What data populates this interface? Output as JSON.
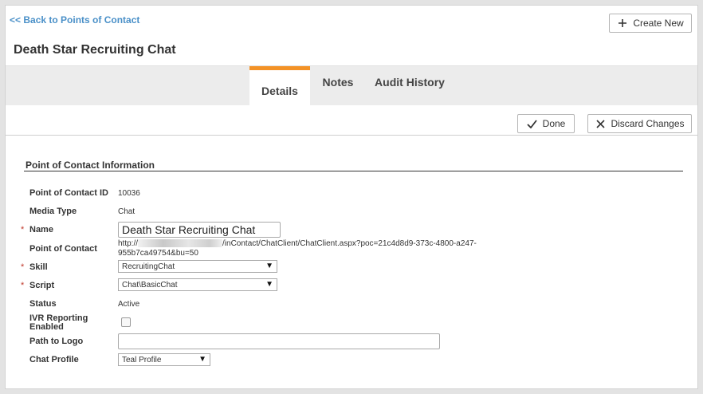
{
  "header": {
    "back_link": "<< Back to Points of Contact",
    "create_new_label": "Create New",
    "page_title": "Death Star Recruiting Chat"
  },
  "tabs": [
    {
      "label": "Details",
      "active": true
    },
    {
      "label": "Notes",
      "active": false
    },
    {
      "label": "Audit History",
      "active": false
    }
  ],
  "toolbar": {
    "done_label": "Done",
    "discard_label": "Discard Changes"
  },
  "section": {
    "title": "Point of Contact Information"
  },
  "form": {
    "poc_id": {
      "label": "Point of Contact ID",
      "value": "10036"
    },
    "media_type": {
      "label": "Media Type",
      "value": "Chat"
    },
    "name": {
      "label": "Name",
      "required": true,
      "value": "Death Star Recruiting Chat"
    },
    "point_of_contact": {
      "label": "Point of Contact",
      "url_prefix": "http://",
      "url_suffix_line1": "/inContact/ChatClient/ChatClient.aspx?poc=21c4d8d9-373c-4800-a247-",
      "url_line2": "955b7ca49754&bu=50"
    },
    "skill": {
      "label": "Skill",
      "required": true,
      "value": "RecruitingChat"
    },
    "script": {
      "label": "Script",
      "required": true,
      "value": "Chat\\BasicChat"
    },
    "status": {
      "label": "Status",
      "value": "Active"
    },
    "ivr_reporting": {
      "label_line1": "IVR Reporting",
      "label_line2": "Enabled",
      "checked": false
    },
    "path_to_logo": {
      "label": "Path to Logo",
      "value": ""
    },
    "chat_profile": {
      "label": "Chat Profile",
      "value": "Teal Profile"
    },
    "required_marker": "*"
  },
  "colors": {
    "tab_accent": "#f39226",
    "link": "#4a90c8",
    "required": "#c0392b"
  }
}
